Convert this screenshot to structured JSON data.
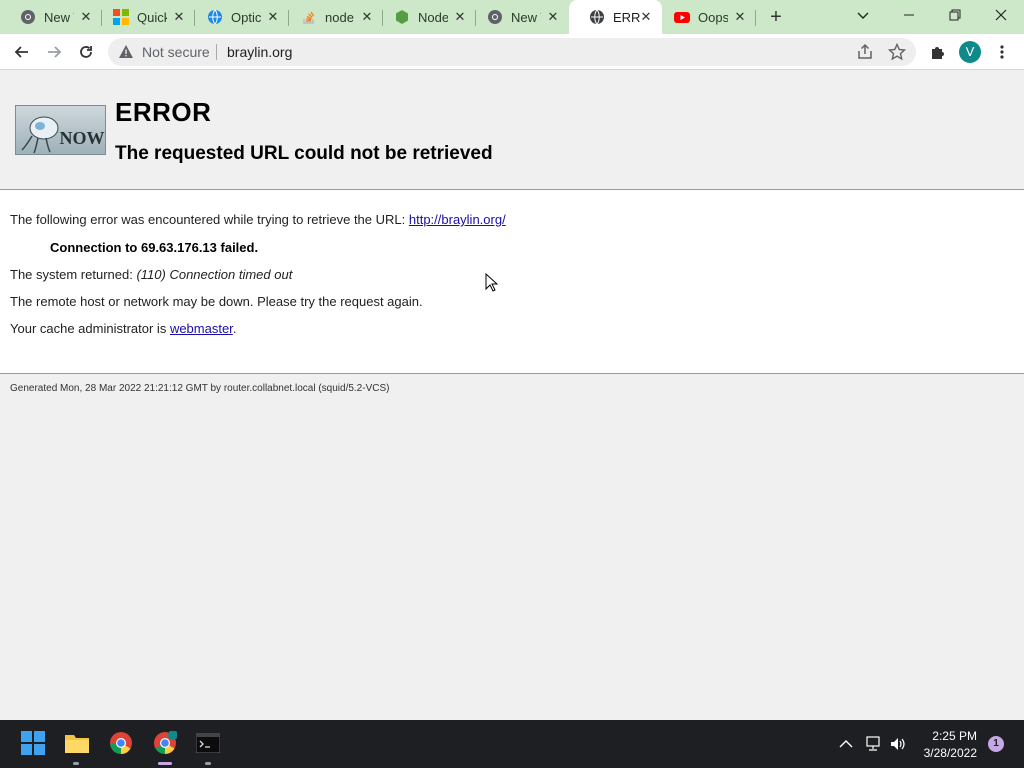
{
  "browser": {
    "tabs": [
      {
        "title": "New Tab",
        "icon": "chrome-icon",
        "active": false
      },
      {
        "title": "Quick",
        "icon": "microsoft-icon",
        "active": false
      },
      {
        "title": "Optic",
        "icon": "globe-icon",
        "active": false
      },
      {
        "title": "node",
        "icon": "stackoverflow-icon",
        "active": false
      },
      {
        "title": "Node",
        "icon": "nodejs-icon",
        "active": false
      },
      {
        "title": "New Tab",
        "icon": "chrome-icon",
        "active": false
      },
      {
        "title": "ERROR",
        "icon": "globe-icon",
        "active": true
      },
      {
        "title": "Oops",
        "icon": "youtube-icon",
        "active": false
      }
    ],
    "new_tab_label": "+",
    "omnibox": {
      "security_label": "Not secure",
      "url": "braylin.org"
    },
    "profile_initial": "V"
  },
  "page": {
    "title": "ERROR",
    "subtitle": "The requested URL could not be retrieved",
    "logo_alt": "NOW",
    "intro_text": "The following error was encountered while trying to retrieve the URL: ",
    "intro_link": "http://braylin.org/",
    "connection_failed": "Connection to 69.63.176.13 failed.",
    "system_returned_label": "The system returned: ",
    "system_returned_value": "(110) Connection timed out",
    "remote_host_msg": "The remote host or network may be down. Please try the request again.",
    "cache_admin_label": "Your cache administrator is ",
    "cache_admin_link": "webmaster",
    "cache_admin_suffix": ".",
    "footer": "Generated Mon, 28 Mar 2022 21:21:12 GMT by router.collabnet.local (squid/5.2-VCS)"
  },
  "taskbar": {
    "apps": [
      {
        "name": "start",
        "icon": "windows-icon"
      },
      {
        "name": "file-explorer",
        "icon": "folder-icon"
      },
      {
        "name": "chrome",
        "icon": "chrome-icon"
      },
      {
        "name": "chrome-profile",
        "icon": "chrome-icon"
      },
      {
        "name": "terminal",
        "icon": "terminal-icon"
      }
    ],
    "time": "2:25 PM",
    "date": "3/28/2022",
    "notification_count": "1"
  },
  "colors": {
    "tab_strip": "#cde8c9",
    "link": "#1a0dab",
    "avatar": "#0f8a8a",
    "taskbar": "#1e1f22"
  }
}
